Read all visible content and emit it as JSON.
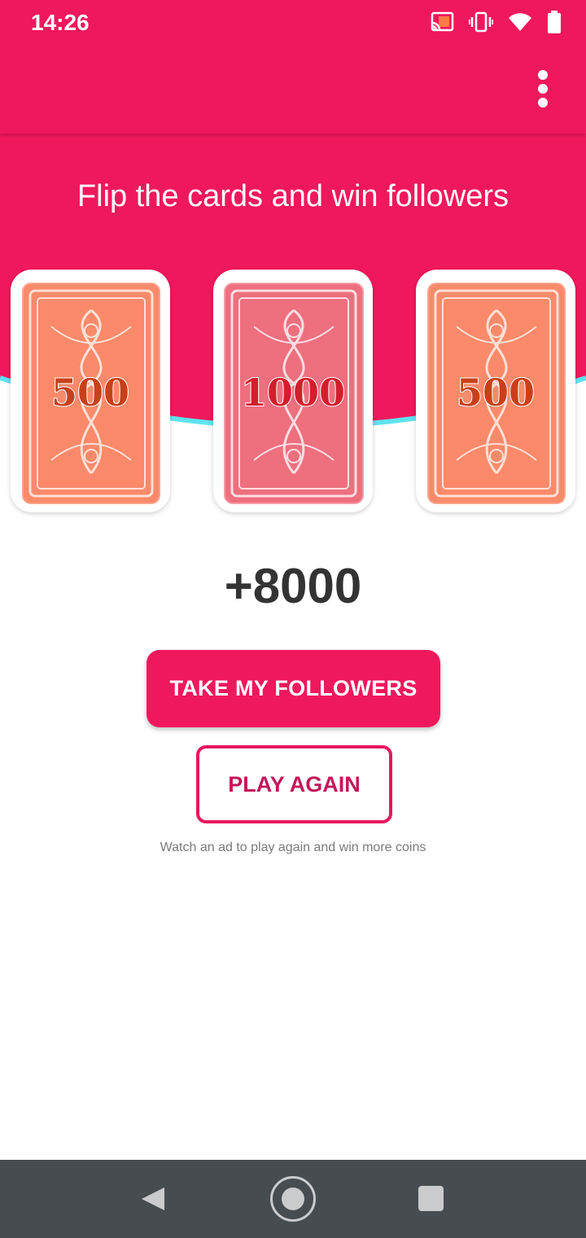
{
  "status_bar": {
    "time": "14:26",
    "icons": [
      "cast-icon",
      "vibrate-icon",
      "wifi-icon",
      "battery-icon"
    ]
  },
  "app_bar": {
    "menu_icon": "more-vert-icon"
  },
  "hero": {
    "title": "Flip the cards and win followers"
  },
  "cards": [
    {
      "value": "500"
    },
    {
      "value": "1000"
    },
    {
      "value": "500"
    }
  ],
  "result": {
    "points": "+8000"
  },
  "actions": {
    "take_label": "TAKE MY FOLLOWERS",
    "play_again_label": "PLAY AGAIN",
    "hint": "Watch an ad to play again and win more coins"
  },
  "nav_bar": {
    "icons": [
      "back-icon",
      "home-icon",
      "recents-icon"
    ]
  },
  "colors": {
    "primary": "#f0185c",
    "accent_line": "#5fe3ee",
    "card_orange": "#fa8a6a",
    "card_pink": "#ee6f7e",
    "text_dark": "#333333",
    "nav_bg": "#474c51"
  }
}
